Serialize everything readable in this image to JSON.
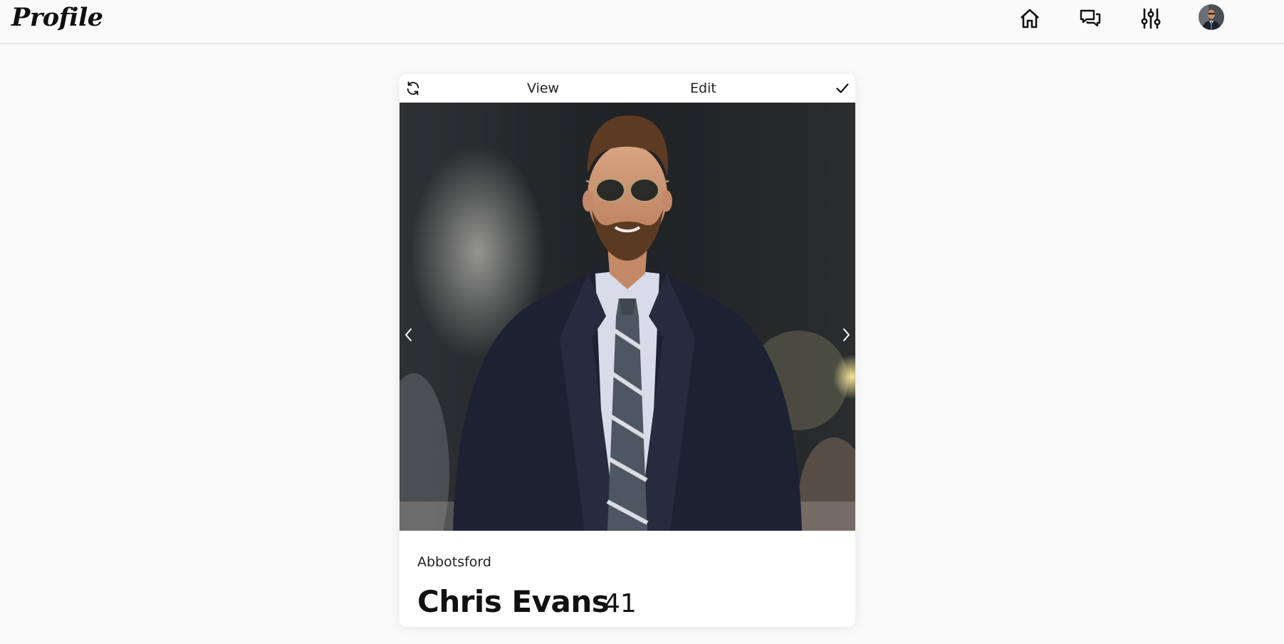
{
  "header": {
    "logo": "Profile",
    "nav": [
      {
        "name": "home",
        "icon": "home-icon"
      },
      {
        "name": "messages",
        "icon": "chat-bubbles-icon"
      },
      {
        "name": "filters",
        "icon": "sliders-icon"
      },
      {
        "name": "account",
        "icon": "avatar-icon"
      }
    ]
  },
  "card": {
    "toolbar": {
      "refresh_icon": "refresh-icon",
      "view_label": "View",
      "edit_label": "Edit",
      "confirm_icon": "check-icon"
    },
    "photo": {
      "prev_icon": "chevron-left-icon",
      "next_icon": "chevron-right-icon"
    },
    "profile": {
      "location": "Abbotsford",
      "name": "Chris Evans",
      "age": "41"
    }
  },
  "colors": {
    "page_background": "#fafafa",
    "card_background": "#ffffff",
    "text": "#111111",
    "suit": "#1d2233"
  }
}
